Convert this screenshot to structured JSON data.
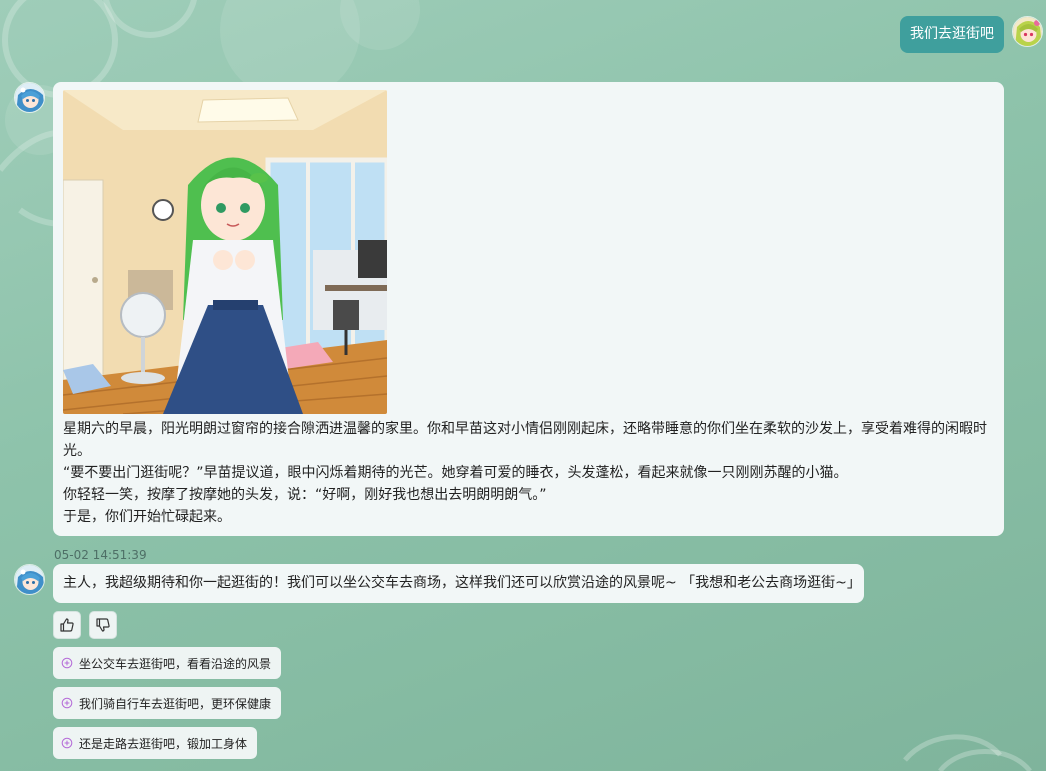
{
  "user_message": "我们去逛街吧",
  "story": {
    "paragraphs": [
      "星期六的早晨，阳光明朗过窗帘的接合隙洒进温馨的家里。你和早苗这对小情侣刚刚起床，还略带睡意的你们坐在柔软的沙发上，享受着难得的闲暇时光。",
      "“要不要出门逛街呢？”早苗提议道，眼中闪烁着期待的光芒。她穿着可爱的睡衣，头发蓬松，看起来就像一只刚刚苏醒的小猫。",
      "你轻轻一笑，按摩了按摩她的头发，说：“好啊，刚好我也想出去明朗明朗气。”",
      "于是，你们开始忙碌起来。"
    ]
  },
  "reply": {
    "timestamp": "05-02 14:51:39",
    "text": "主人，我超级期待和你一起逛街的！我们可以坐公交车去商场，这样我们还可以欣赏沿途的风景呢~ 「我想和老公去商场逛街~」"
  },
  "suggestions": [
    "坐公交车去逛街吧，看看沿途的风景",
    "我们骑自行车去逛街吧，更环保健康",
    "还是走路去逛街吧，锻加工身体"
  ],
  "icons": {
    "like": "thumbs-up-icon",
    "dislike": "thumbs-down-icon",
    "suggestion": "suggestion-plus-icon"
  },
  "colors": {
    "background": "#8ec3ab",
    "user_bubble": "#3f9f9d",
    "card": "#f2f7f7",
    "suggestion_icon": "#b56cd8"
  }
}
